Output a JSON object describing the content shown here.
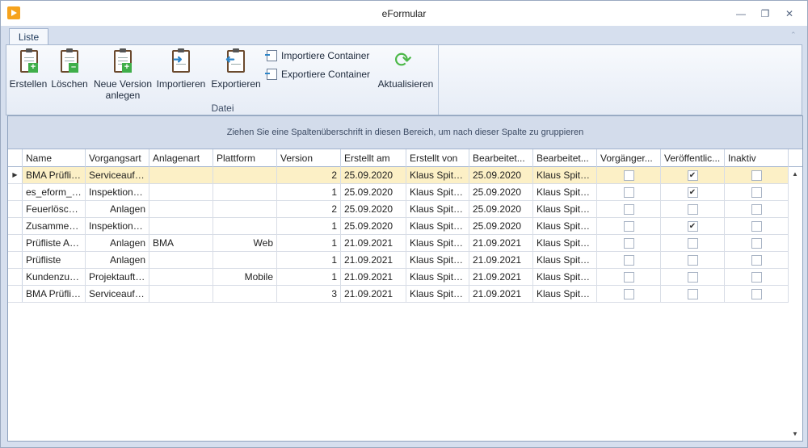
{
  "window": {
    "title": "eFormular",
    "colors": {
      "accent": "#f6a31d",
      "selection": "#fcf0c6",
      "ribbon": "#d6dfee"
    }
  },
  "tabs": [
    {
      "label": "Liste"
    }
  ],
  "ribbon": {
    "group_label": "Datei",
    "buttons": {
      "create": "Erstellen",
      "delete": "Löschen",
      "new_version_1": "Neue Version",
      "new_version_2": "anlegen",
      "import": "Importieren",
      "export": "Exportieren",
      "import_container": "Importiere Container",
      "export_container": "Exportiere Container",
      "refresh": "Aktualisieren"
    }
  },
  "grid": {
    "group_hint": "Ziehen Sie eine Spaltenüberschrift in diesen Bereich, um nach dieser Spalte zu gruppieren",
    "columns": [
      "Name",
      "Vorgangsart",
      "Anlagenart",
      "Plattform",
      "Version",
      "Erstellt am",
      "Erstellt von",
      "Bearbeitet...",
      "Bearbeitet...",
      "Vorgänger...",
      "Veröffentlic...",
      "Inaktiv"
    ],
    "rows": [
      {
        "name": "BMA Prüflis...",
        "vorgangsart": "Serviceauftr...",
        "anlagenart": "",
        "plattform": "",
        "version": "2",
        "erstellt_am": "25.09.2020",
        "erstellt_von": "Klaus Spitz...",
        "bearbeitet_am": "25.09.2020",
        "bearbeitet_von": "Klaus Spitz...",
        "vorgaenger": false,
        "veroeffentlicht": true,
        "inaktiv": false,
        "selected": true
      },
      {
        "name": "es_eform_C...",
        "vorgangsart": "Inspektions...",
        "anlagenart": "",
        "plattform": "",
        "version": "1",
        "erstellt_am": "25.09.2020",
        "erstellt_von": "Klaus Spitz...",
        "bearbeitet_am": "25.09.2020",
        "bearbeitet_von": "Klaus Spitz...",
        "vorgaenger": false,
        "veroeffentlicht": true,
        "inaktiv": false
      },
      {
        "name": "Feuerlösch...",
        "vorgangsart": "Anlagen",
        "anlagenart": "",
        "plattform": "",
        "version": "2",
        "erstellt_am": "25.09.2020",
        "erstellt_von": "Klaus Spitz...",
        "bearbeitet_am": "25.09.2020",
        "bearbeitet_von": "Klaus Spitz...",
        "vorgaenger": false,
        "veroeffentlicht": false,
        "inaktiv": false
      },
      {
        "name": "Zusammen...",
        "vorgangsart": "Inspektions...",
        "anlagenart": "",
        "plattform": "",
        "version": "1",
        "erstellt_am": "25.09.2020",
        "erstellt_von": "Klaus Spitz...",
        "bearbeitet_am": "25.09.2020",
        "bearbeitet_von": "Klaus Spitz...",
        "vorgaenger": false,
        "veroeffentlicht": true,
        "inaktiv": false
      },
      {
        "name": "Prüfliste An...",
        "vorgangsart": "Anlagen",
        "anlagenart": "BMA",
        "plattform": "Web",
        "version": "1",
        "erstellt_am": "21.09.2021",
        "erstellt_von": "Klaus Spitz...",
        "bearbeitet_am": "21.09.2021",
        "bearbeitet_von": "Klaus Spitz...",
        "vorgaenger": false,
        "veroeffentlicht": false,
        "inaktiv": false
      },
      {
        "name": "Prüfliste",
        "vorgangsart": "Anlagen",
        "anlagenart": "",
        "plattform": "",
        "version": "1",
        "erstellt_am": "21.09.2021",
        "erstellt_von": "Klaus Spitz...",
        "bearbeitet_am": "21.09.2021",
        "bearbeitet_von": "Klaus Spitz...",
        "vorgaenger": false,
        "veroeffentlicht": false,
        "inaktiv": false
      },
      {
        "name": "Kundenzufr...",
        "vorgangsart": "Projektauftr...",
        "anlagenart": "",
        "plattform": "Mobile",
        "version": "1",
        "erstellt_am": "21.09.2021",
        "erstellt_von": "Klaus Spitz...",
        "bearbeitet_am": "21.09.2021",
        "bearbeitet_von": "Klaus Spitz...",
        "vorgaenger": false,
        "veroeffentlicht": false,
        "inaktiv": false
      },
      {
        "name": "BMA Prüflis...",
        "vorgangsart": "Serviceauftr...",
        "anlagenart": "",
        "plattform": "",
        "version": "3",
        "erstellt_am": "21.09.2021",
        "erstellt_von": "Klaus Spitz...",
        "bearbeitet_am": "21.09.2021",
        "bearbeitet_von": "Klaus Spitz...",
        "vorgaenger": false,
        "veroeffentlicht": false,
        "inaktiv": false
      }
    ]
  }
}
